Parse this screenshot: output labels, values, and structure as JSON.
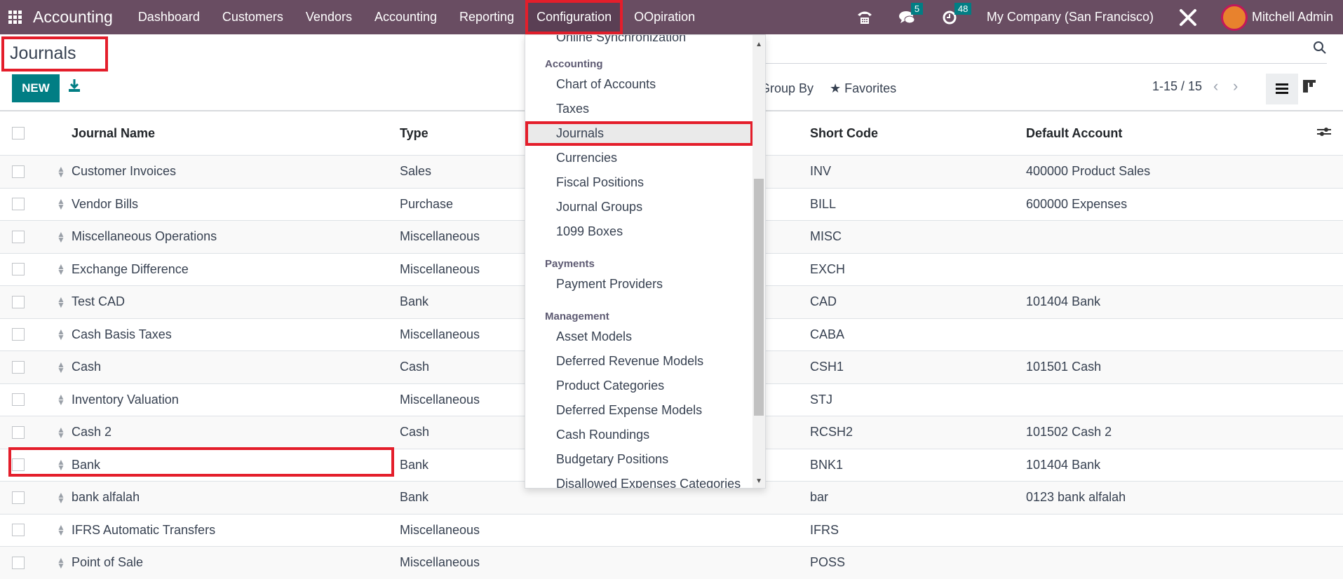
{
  "navbar": {
    "app_name": "Accounting",
    "menu": [
      "Dashboard",
      "Customers",
      "Vendors",
      "Accounting",
      "Reporting",
      "Configuration",
      "OOpiration"
    ],
    "active_menu": "Configuration",
    "messages_count": "5",
    "activities_count": "48",
    "company": "My Company (San Francisco)",
    "user": "Mitchell Admin"
  },
  "control_panel": {
    "title": "Journals",
    "new_label": "NEW",
    "group_by_label": "Group By",
    "favorites_label": "Favorites",
    "pager": "1-15 / 15"
  },
  "table": {
    "columns": [
      "Journal Name",
      "Type",
      "Short Code",
      "Default Account"
    ],
    "rows": [
      {
        "name": "Customer Invoices",
        "type": "Sales",
        "code": "INV",
        "account": "400000 Product Sales"
      },
      {
        "name": "Vendor Bills",
        "type": "Purchase",
        "code": "BILL",
        "account": "600000 Expenses"
      },
      {
        "name": "Miscellaneous Operations",
        "type": "Miscellaneous",
        "code": "MISC",
        "account": ""
      },
      {
        "name": "Exchange Difference",
        "type": "Miscellaneous",
        "code": "EXCH",
        "account": ""
      },
      {
        "name": "Test CAD",
        "type": "Bank",
        "code": "CAD",
        "account": "101404 Bank"
      },
      {
        "name": "Cash Basis Taxes",
        "type": "Miscellaneous",
        "code": "CABA",
        "account": ""
      },
      {
        "name": "Cash",
        "type": "Cash",
        "code": "CSH1",
        "account": "101501 Cash"
      },
      {
        "name": "Inventory Valuation",
        "type": "Miscellaneous",
        "code": "STJ",
        "account": ""
      },
      {
        "name": "Cash 2",
        "type": "Cash",
        "code": "RCSH2",
        "account": "101502 Cash 2"
      },
      {
        "name": "Bank",
        "type": "Bank",
        "code": "BNK1",
        "account": "101404 Bank"
      },
      {
        "name": "bank alfalah",
        "type": "Bank",
        "code": "bar",
        "account": "0123 bank alfalah"
      },
      {
        "name": "IFRS Automatic Transfers",
        "type": "Miscellaneous",
        "code": "IFRS",
        "account": ""
      },
      {
        "name": "Point of Sale",
        "type": "Miscellaneous",
        "code": "POSS",
        "account": ""
      }
    ]
  },
  "dropdown": {
    "clipped_item": "Online Synchronization",
    "sections": [
      {
        "header": "Accounting",
        "items": [
          "Chart of Accounts",
          "Taxes",
          "Journals",
          "Currencies",
          "Fiscal Positions",
          "Journal Groups",
          "1099 Boxes"
        ]
      },
      {
        "header": "Payments",
        "items": [
          "Payment Providers"
        ]
      },
      {
        "header": "Management",
        "items": [
          "Asset Models",
          "Deferred Revenue Models",
          "Product Categories",
          "Deferred Expense Models",
          "Cash Roundings",
          "Budgetary Positions",
          "Disallowed Expenses Categories"
        ]
      }
    ],
    "selected_item": "Journals"
  },
  "colors": {
    "navbar": "#694d62",
    "primary": "#017e84",
    "highlight": "#e41e2b"
  }
}
